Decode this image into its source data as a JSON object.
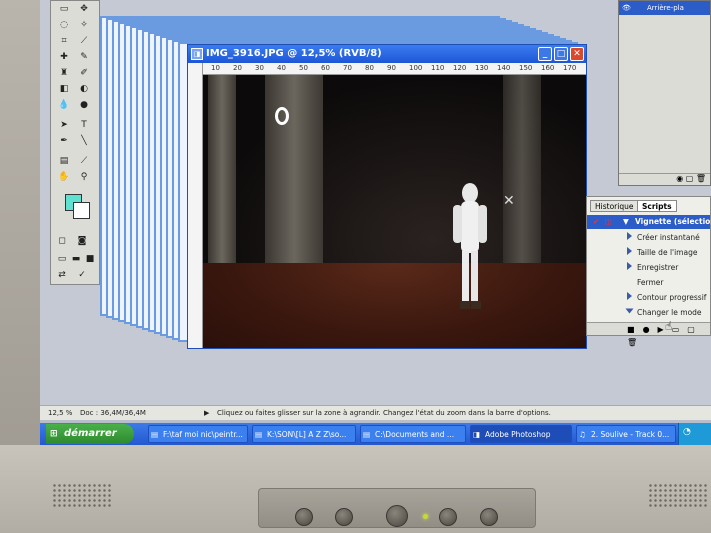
{
  "image_window": {
    "title": "IMG_3916.JPG @ 12,5% (RVB/8)",
    "ruler_ticks": [
      "10",
      "20",
      "30",
      "40",
      "50",
      "60",
      "70",
      "80",
      "90",
      "100",
      "110",
      "120",
      "130",
      "140",
      "150",
      "160",
      "170"
    ]
  },
  "panels": {
    "layers": {
      "layer_name": "Arrière-pla"
    },
    "history": {
      "tabs": [
        "Historique",
        "Scripts"
      ],
      "actions": [
        {
          "label": "Vignette (sélection)",
          "selected": true
        },
        {
          "label": "Créer instantané"
        },
        {
          "label": "Taille de l'image"
        },
        {
          "label": "Enregistrer"
        },
        {
          "label": "Fermer"
        },
        {
          "label": "Contour progressif"
        },
        {
          "label": "Changer le mode"
        }
      ]
    }
  },
  "statusbar": {
    "zoom": "12,5 %",
    "doc": "Doc : 36,4M/36,4M",
    "hint": "Cliquez ou faites glisser sur la zone à agrandir. Changez l'état du zoom dans la barre d'options."
  },
  "taskbar": {
    "start_label": "démarrer",
    "tasks": [
      {
        "label": "F:\\taf moi nic\\peintr..."
      },
      {
        "label": "K:\\SON\\[L] A Z Z\\so..."
      },
      {
        "label": "C:\\Documents and ..."
      },
      {
        "label": "Adobe Photoshop"
      },
      {
        "label": "2. Soulive - Track 0..."
      }
    ]
  },
  "colors": {
    "foreground": "#60e0d0",
    "background": "#ffffff",
    "accent": "#1e56d6"
  }
}
